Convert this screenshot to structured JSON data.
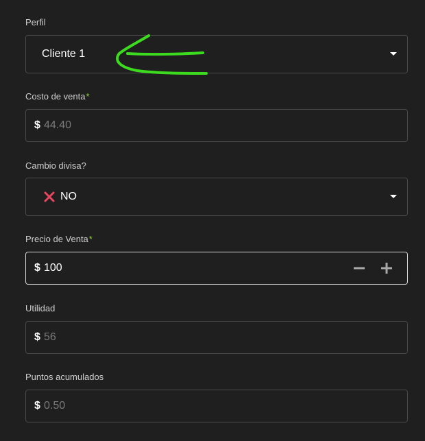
{
  "profile": {
    "label": "Perfil",
    "value": "Cliente 1"
  },
  "sale_cost": {
    "label": "Costo de venta",
    "required_mark": "*",
    "currency": "$",
    "value": "44.40"
  },
  "currency_change": {
    "label": "Cambio divisa?",
    "value": "NO",
    "icon": "x-mark-icon"
  },
  "sale_price": {
    "label": "Precio de Venta",
    "required_mark": "*",
    "currency": "$",
    "value": "100"
  },
  "profit": {
    "label": "Utilidad",
    "currency": "$",
    "value": "56"
  },
  "points": {
    "label": "Puntos acumulados",
    "currency": "$",
    "value": "0.50"
  },
  "colors": {
    "background": "#1f1f1f",
    "border": "#4a4a4a",
    "required": "#8fd13d",
    "x_mark": "#e8455f",
    "annotation": "#3ddb1f"
  }
}
